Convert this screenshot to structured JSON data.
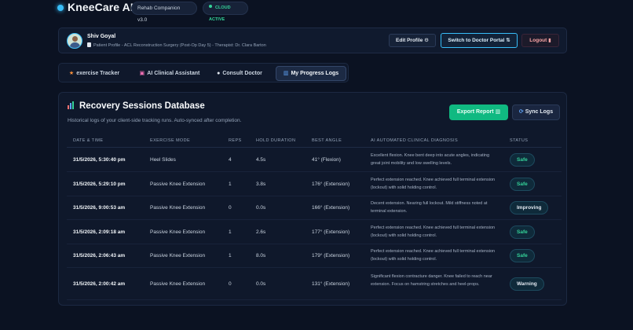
{
  "header": {
    "brand": "KneeCare AI",
    "version_pill": "Rehab Companion v3.0",
    "cloud_pill": "CLOUD ACTIVE"
  },
  "profile": {
    "name": "Shiv Goyal",
    "subtitle": "Patient Profile - ACL Reconstruction Surgery (Post-Op Day 5) - Therapist: Dr. Clara Barton",
    "edit_label": "Edit Profile",
    "switch_label": "Switch to Doctor Portal",
    "logout_label": "Logout"
  },
  "tabs": [
    {
      "label": "exercise Tracker",
      "icon": "running-icon"
    },
    {
      "label": "AI Clinical Assistant",
      "icon": "robot-icon"
    },
    {
      "label": "Consult Doctor",
      "icon": "chat-icon"
    },
    {
      "label": "My Progress Logs",
      "icon": "chart-icon",
      "active": true
    }
  ],
  "database": {
    "title": "Recovery Sessions Database",
    "subtitle": "Historical logs of your client-side tracking runs. Auto-synced after completion.",
    "export_label": "Export Report",
    "sync_label": "Sync Logs",
    "columns": [
      "DATE & TIME",
      "EXERCISE MODE",
      "REPS",
      "HOLD DURATION",
      "BEST ANGLE",
      "AI AUTOMATED CLINICAL DIAGNOSIS",
      "STATUS"
    ],
    "rows": [
      {
        "date": "31/5/2026, 5:30:40 pm",
        "mode": "Heel Slides",
        "reps": "4",
        "hold": "4.5s",
        "angle": "41° (Flexion)",
        "diagnosis": "Excellent flexion. Knee bent deep into acute angles, indicating great joint mobility and low swelling levels.",
        "status": "Safe"
      },
      {
        "date": "31/5/2026, 5:29:10 pm",
        "mode": "Passive Knee Extension",
        "reps": "1",
        "hold": "3.8s",
        "angle": "176° (Extension)",
        "diagnosis": "Perfect extension reached. Knee achieved full terminal extension (lockout) with solid holding control.",
        "status": "Safe"
      },
      {
        "date": "31/5/2026, 9:00:53 am",
        "mode": "Passive Knee Extension",
        "reps": "0",
        "hold": "0.0s",
        "angle": "166° (Extension)",
        "diagnosis": "Decent extension. Nearing full lockout. Mild stiffness noted at terminal extension.",
        "status": "Improving"
      },
      {
        "date": "31/5/2026, 2:09:18 am",
        "mode": "Passive Knee Extension",
        "reps": "1",
        "hold": "2.6s",
        "angle": "177° (Extension)",
        "diagnosis": "Perfect extension reached. Knee achieved full terminal extension (lockout) with solid holding control.",
        "status": "Safe"
      },
      {
        "date": "31/5/2026, 2:06:43 am",
        "mode": "Passive Knee Extension",
        "reps": "1",
        "hold": "8.0s",
        "angle": "179° (Extension)",
        "diagnosis": "Perfect extension reached. Knee achieved full terminal extension (lockout) with solid holding control.",
        "status": "Safe"
      },
      {
        "date": "31/5/2026, 2:00:42 am",
        "mode": "Passive Knee Extension",
        "reps": "0",
        "hold": "0.0s",
        "angle": "131° (Extension)",
        "diagnosis": "Significant flexion contracture danger. Knee failed to reach near extension. Focus on hamstring stretches and heel-props.",
        "status": "Warning"
      }
    ]
  },
  "colors": {
    "background": "#0b1222",
    "accent": "#38bdf8",
    "success": "#10b981",
    "safe_text": "#34d399"
  }
}
